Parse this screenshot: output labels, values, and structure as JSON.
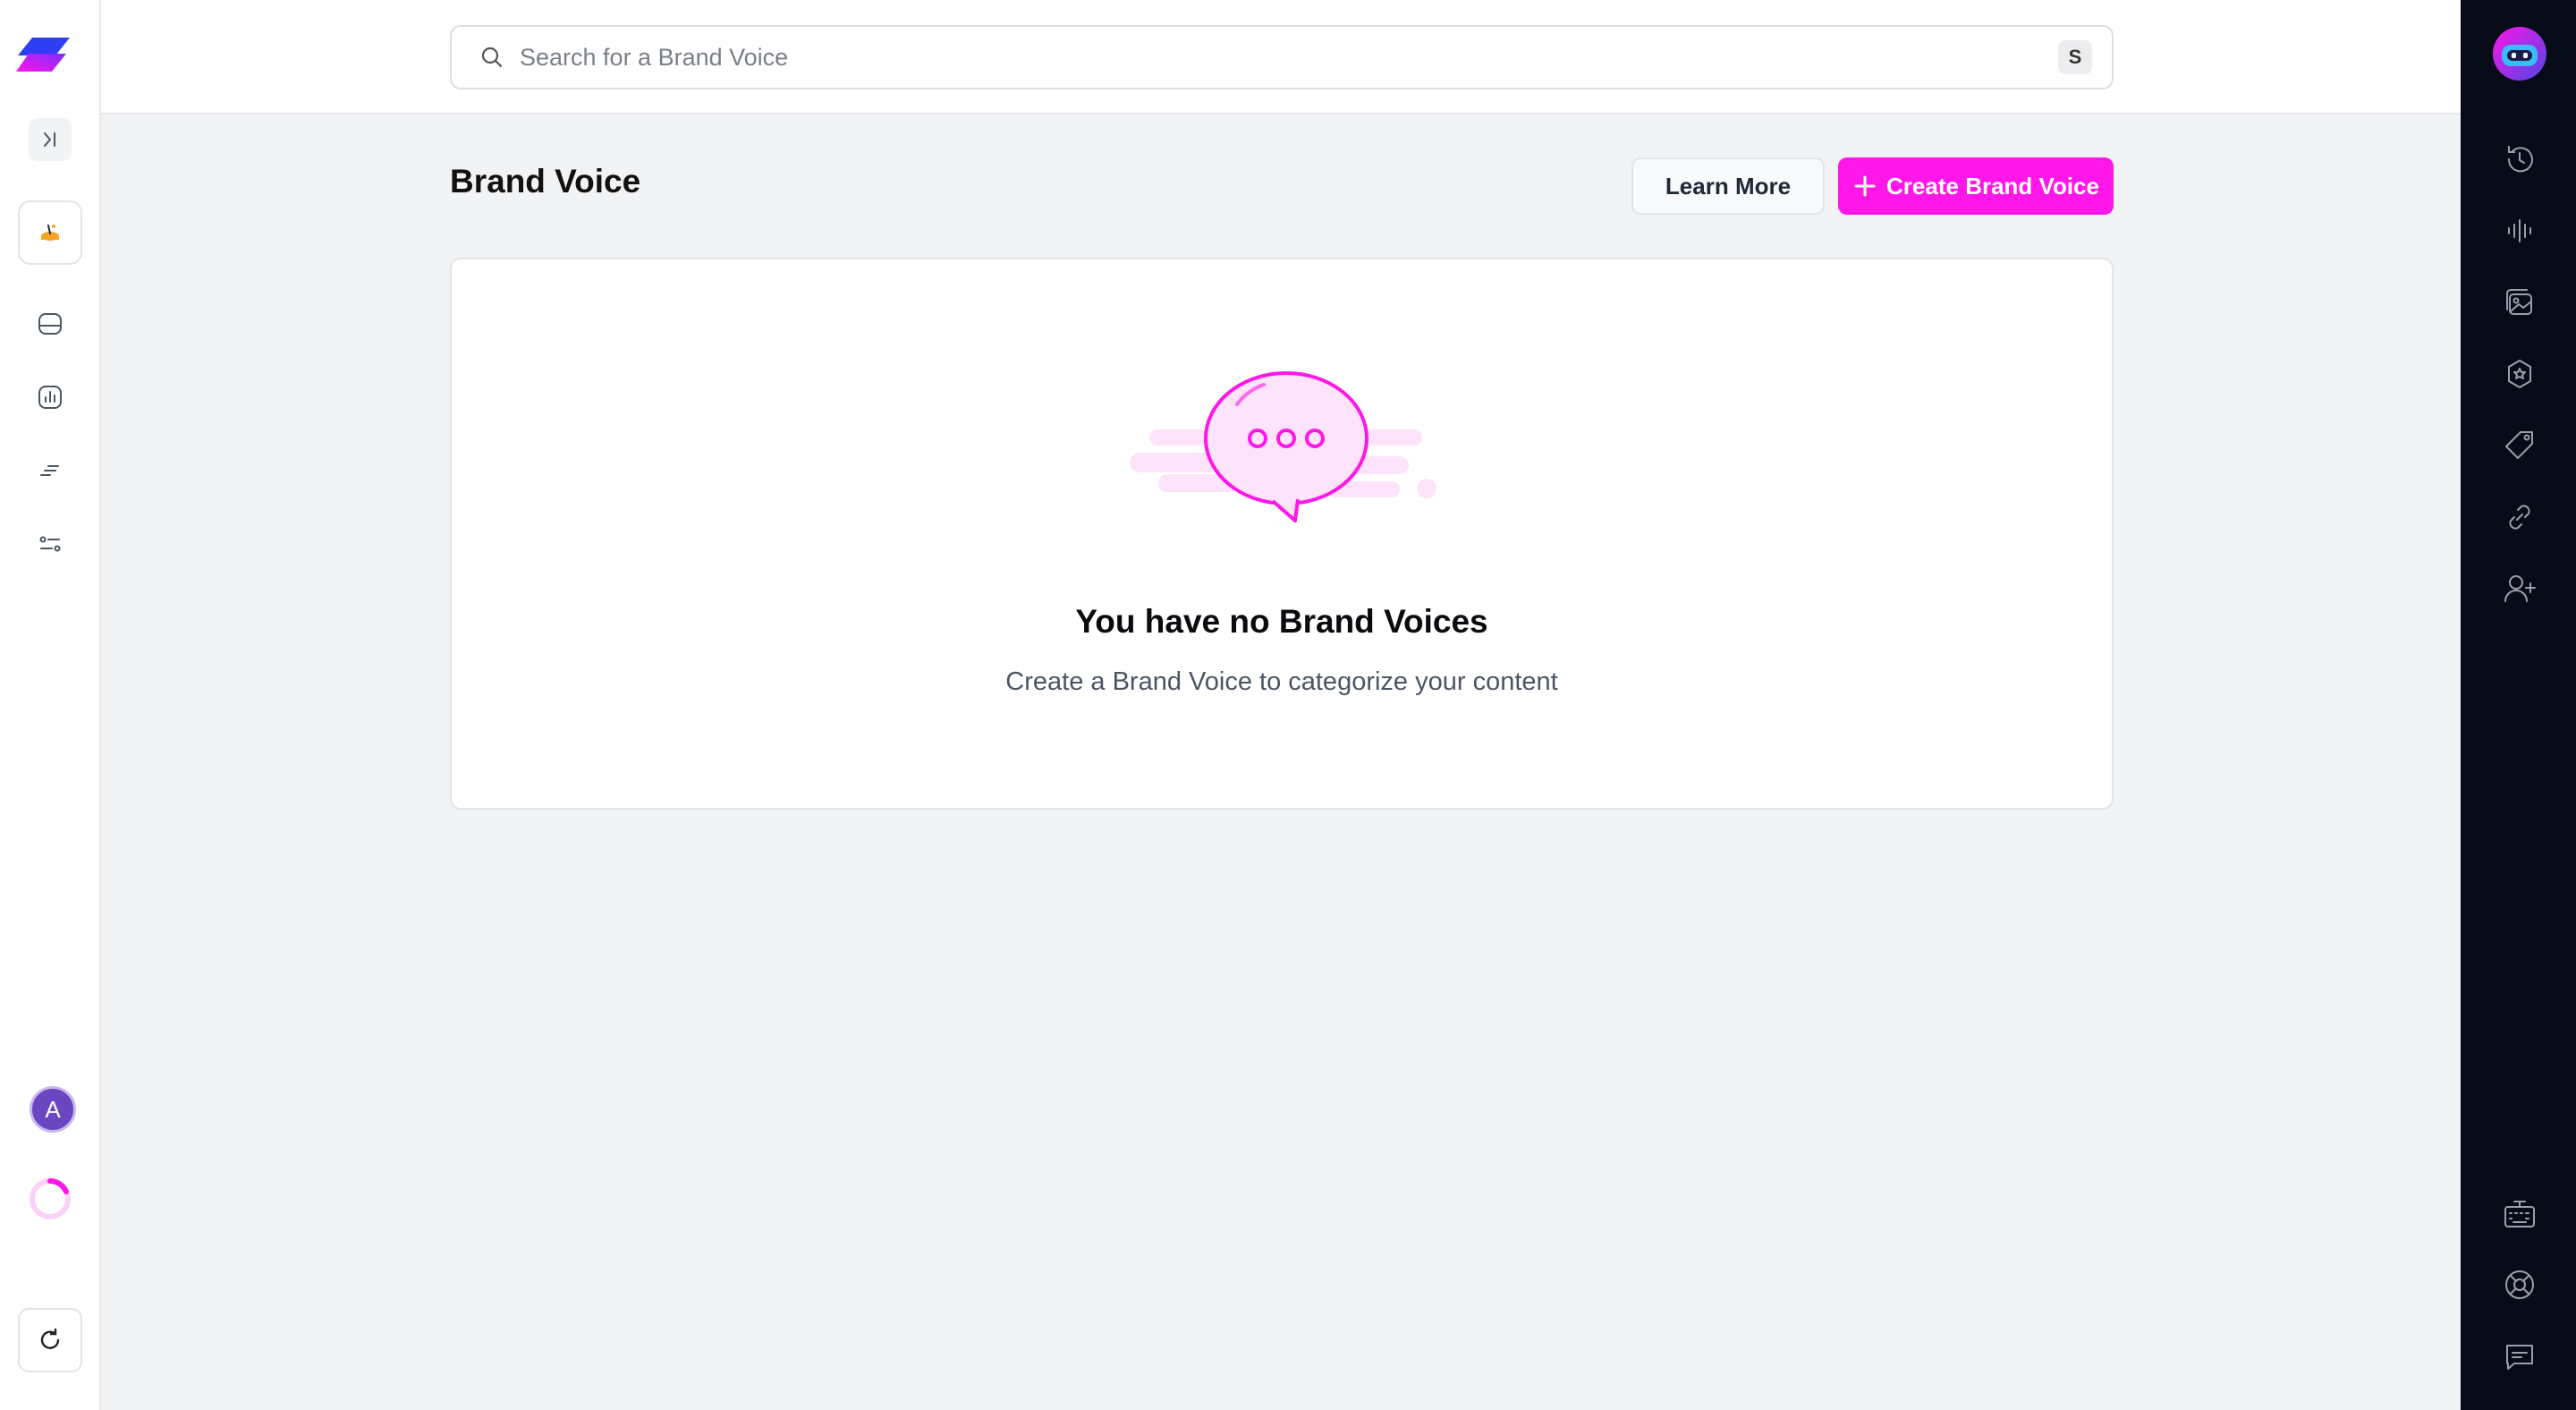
{
  "search": {
    "placeholder": "Search for a Brand Voice",
    "shortcut": "S"
  },
  "page": {
    "title": "Brand Voice",
    "learn_more_label": "Learn More",
    "create_label": "Create Brand Voice"
  },
  "empty_state": {
    "title": "You have no Brand Voices",
    "subtitle": "Create a Brand Voice to categorize your content"
  },
  "user": {
    "initial": "A"
  },
  "left_sidebar": {
    "icons": [
      "logo",
      "collapse-sidebar-icon",
      "feature-icon",
      "chat-icon",
      "analytics-icon",
      "text-lines-icon",
      "settings-sliders-icon",
      "refresh-icon"
    ]
  },
  "right_rail": {
    "icons": [
      "assistant-avatar",
      "history-icon",
      "audio-wave-icon",
      "image-gallery-icon",
      "badge-icon",
      "tag-icon",
      "link-icon",
      "add-user-icon",
      "keyboard-icon",
      "help-lifebuoy-icon",
      "feedback-icon"
    ]
  },
  "colors": {
    "accent": "#ff16e8",
    "rail_bg": "#070a17",
    "avatar_bg": "#6b46c1"
  }
}
